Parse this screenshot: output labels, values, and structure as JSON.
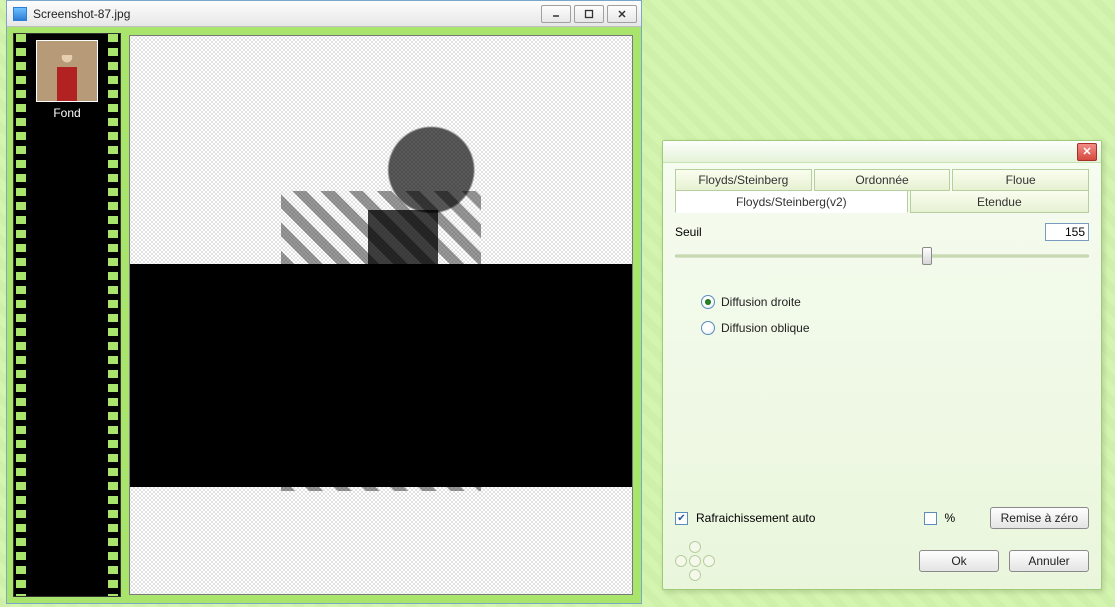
{
  "editor": {
    "title": "Screenshot-87.jpg",
    "layer_label": "Fond"
  },
  "dialog": {
    "tabs_row1": [
      "Floyds/Steinberg",
      "Ordonnée",
      "Floue"
    ],
    "tabs_row2": [
      "Floyds/Steinberg(v2)",
      "Etendue"
    ],
    "selected_tab": "Floyds/Steinberg(v2)",
    "seuil_label": "Seuil",
    "seuil_value": "155",
    "seuil_min": 0,
    "seuil_max": 255,
    "diffusion": {
      "options": [
        "Diffusion droite",
        "Diffusion oblique"
      ],
      "selected": "Diffusion droite"
    },
    "auto_refresh_label": "Rafraichissement auto",
    "auto_refresh_checked": true,
    "percent_label": "%",
    "percent_checked": false,
    "reset_label": "Remise à zéro",
    "ok_label": "Ok",
    "cancel_label": "Annuler"
  }
}
